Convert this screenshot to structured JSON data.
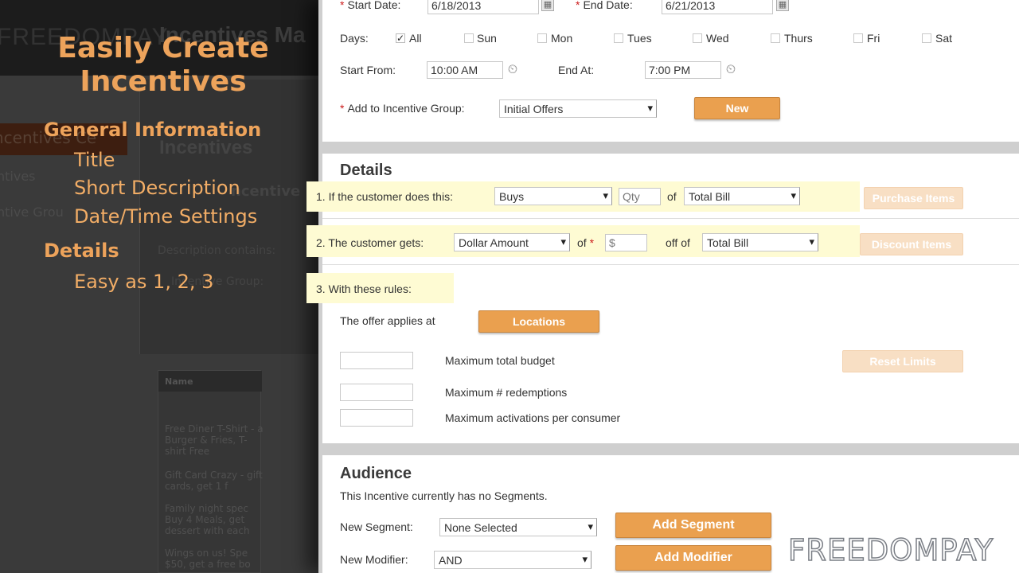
{
  "background_app": {
    "logo": "FREEDOMPAY",
    "app_title": "Incentives Ma",
    "nav_active": "ncentives Ce",
    "side_items": [
      "ntives",
      "ntive Grou"
    ],
    "page_title": "Incentives",
    "sub_title": "ncentive",
    "description_label": "Description contains:",
    "group_label": "Incentive Group:",
    "table_header": "Name",
    "table_rows": [
      "Free Diner T-Shirt - a Burger & Fries, T-shirt Free",
      "Gift Card Crazy - gift cards, get 1 f",
      "Family night spec Buy 4 Meals, get dessert with each",
      "Wings on us! Spe $50, get a free bo"
    ]
  },
  "overlay": {
    "title": "Easily Create Incentives",
    "section1": "General Information",
    "items1": [
      "Title",
      "Short Description",
      "Date/Time Settings"
    ],
    "section2": "Details",
    "items2": [
      "Easy as 1, 2, 3"
    ]
  },
  "schedule": {
    "start_date_label": "Start Date:",
    "start_date": "6/18/2013",
    "end_date_label": "End Date:",
    "end_date": "6/21/2013",
    "days_label": "Days:",
    "days": [
      {
        "label": "All",
        "checked": true
      },
      {
        "label": "Sun",
        "checked": false
      },
      {
        "label": "Mon",
        "checked": false
      },
      {
        "label": "Tues",
        "checked": false
      },
      {
        "label": "Wed",
        "checked": false
      },
      {
        "label": "Thurs",
        "checked": false
      },
      {
        "label": "Fri",
        "checked": false
      },
      {
        "label": "Sat",
        "checked": false
      }
    ],
    "start_from_label": "Start From:",
    "start_from": "10:00 AM",
    "end_at_label": "End At:",
    "end_at": "7:00 PM",
    "group_label": "Add to Incentive Group:",
    "group_value": "Initial Offers",
    "new_button": "New"
  },
  "details": {
    "heading": "Details",
    "step1_label": "1. If the customer does this:",
    "step1_action": "Buys",
    "step1_qty_placeholder": "Qty",
    "step1_of": "of",
    "step1_target": "Total Bill",
    "purchase_items_button": "Purchase Items",
    "step2_label": "2. The customer gets:",
    "step2_reward": "Dollar Amount",
    "step2_of": "of",
    "step2_amount_placeholder": "$",
    "step2_off_of": "off of",
    "step2_target": "Total Bill",
    "discount_items_button": "Discount Items",
    "step3_label": "3. With these rules:",
    "applies_label": "The offer applies at",
    "locations_button": "Locations",
    "budget_label": "Maximum total budget",
    "redemptions_label": "Maximum # redemptions",
    "activations_label": "Maximum activations per consumer",
    "reset_limits_button": "Reset Limits"
  },
  "audience": {
    "heading": "Audience",
    "no_segments_text": "This Incentive currently has no Segments.",
    "segment_label": "New Segment:",
    "segment_value": "None Selected",
    "add_segment_button": "Add Segment",
    "modifier_label": "New Modifier:",
    "modifier_value": "AND",
    "add_modifier_button": "Add Modifier"
  },
  "brand_logo": "FREEDOMPAY",
  "colors": {
    "accent_orange": "#eaa04f",
    "overlay_orange": "#eda35b",
    "highlight_yellow": "#fefbd3",
    "required_red": "#cc1b1b"
  }
}
